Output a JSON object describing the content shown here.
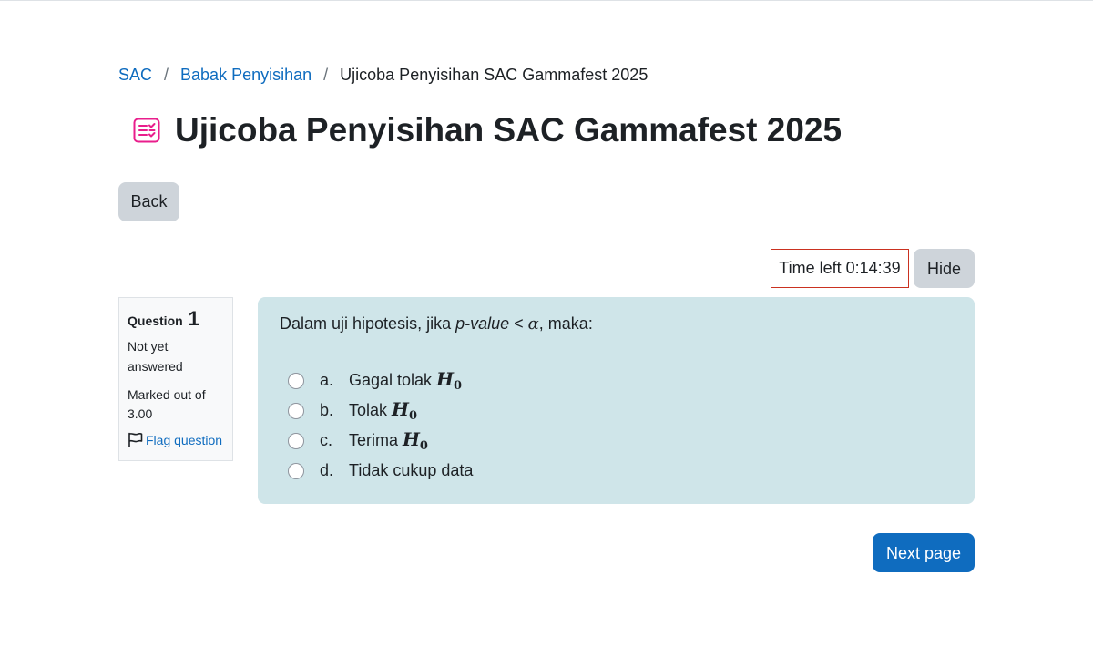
{
  "breadcrumb": {
    "items": [
      "SAC",
      "Babak Penyisihan"
    ],
    "current": "Ujicoba Penyisihan SAC Gammafest 2025",
    "separator": "/"
  },
  "page": {
    "title": "Ujicoba Penyisihan SAC Gammafest 2025",
    "icon": "quiz-icon",
    "icon_color": "#e91e8c"
  },
  "buttons": {
    "back": "Back",
    "hide": "Hide",
    "next": "Next page"
  },
  "timer": {
    "text": "Time left 0:14:39"
  },
  "question_info": {
    "label": "Question",
    "number": "1",
    "state": "Not yet answered",
    "grade": "Marked out of 3.00",
    "flag": "Flag question"
  },
  "question": {
    "text_prefix": "Dalam uji hipotesis, jika ",
    "text_em": "p-value",
    "text_op": " < ",
    "text_alpha": "α",
    "text_suffix": ", maka:",
    "answers": [
      {
        "letter": "a.",
        "text": "Gagal tolak",
        "math": "H",
        "sub": "0"
      },
      {
        "letter": "b.",
        "text": "Tolak",
        "math": "H",
        "sub": "0"
      },
      {
        "letter": "c.",
        "text": "Terima",
        "math": "H",
        "sub": "0"
      },
      {
        "letter": "d.",
        "text": "Tidak cukup data",
        "math": "",
        "sub": ""
      }
    ]
  },
  "colors": {
    "link": "#0f6cbf",
    "primary": "#0f6cbf",
    "secondary": "#ced4da",
    "question_bg": "#cfe5e9",
    "timer_border": "#ca3120"
  }
}
